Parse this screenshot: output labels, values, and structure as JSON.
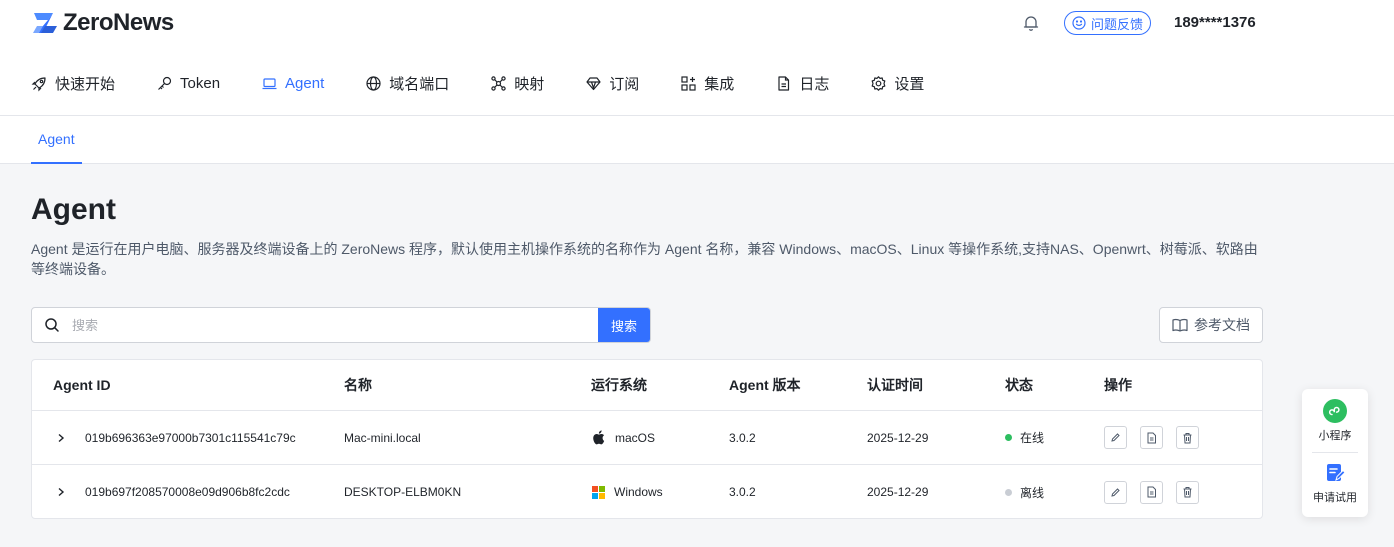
{
  "app": {
    "brand": "ZeroNews",
    "feedback_label": "问题反馈",
    "user": "189****1376"
  },
  "nav": [
    {
      "label": "快速开始",
      "icon": "rocket-icon"
    },
    {
      "label": "Token",
      "icon": "key-icon"
    },
    {
      "label": "Agent",
      "icon": "laptop-icon",
      "active": true
    },
    {
      "label": "域名端口",
      "icon": "globe-icon"
    },
    {
      "label": "映射",
      "icon": "network-icon"
    },
    {
      "label": "订阅",
      "icon": "diamond-icon"
    },
    {
      "label": "集成",
      "icon": "grid-plus-icon"
    },
    {
      "label": "日志",
      "icon": "document-icon"
    },
    {
      "label": "设置",
      "icon": "gear-icon"
    }
  ],
  "subtab": "Agent",
  "page": {
    "title": "Agent",
    "description": "Agent 是运行在用户电脑、服务器及终端设备上的 ZeroNews 程序，默认使用主机操作系统的名称作为 Agent 名称，兼容 Windows、macOS、Linux 等操作系统,支持NAS、Openwrt、树莓派、软路由等终端设备。"
  },
  "search": {
    "placeholder": "搜索",
    "value": "",
    "button": "搜索"
  },
  "docs_button": "参考文档",
  "table": {
    "headers": [
      "Agent ID",
      "名称",
      "运行系统",
      "Agent 版本",
      "认证时间",
      "状态",
      "操作"
    ],
    "rows": [
      {
        "id": "019b696363e97000b7301c115541c79c",
        "name": "Mac-mini.local",
        "os": "macOS",
        "os_icon": "apple-icon",
        "version": "3.0.2",
        "time": "2025-12-29",
        "status": "在线",
        "status_color": "#2dbe60"
      },
      {
        "id": "019b697f208570008e09d906b8fc2cdc",
        "name": "DESKTOP-ELBM0KN",
        "os": "Windows",
        "os_icon": "windows-icon",
        "version": "3.0.2",
        "time": "2025-12-29",
        "status": "离线",
        "status_color": "#c9cdd4"
      }
    ]
  },
  "float": {
    "miniprogram": "小程序",
    "trial": "申请试用"
  },
  "colors": {
    "accent": "#3370ff",
    "online": "#2dbe60",
    "offline": "#c9cdd4"
  }
}
